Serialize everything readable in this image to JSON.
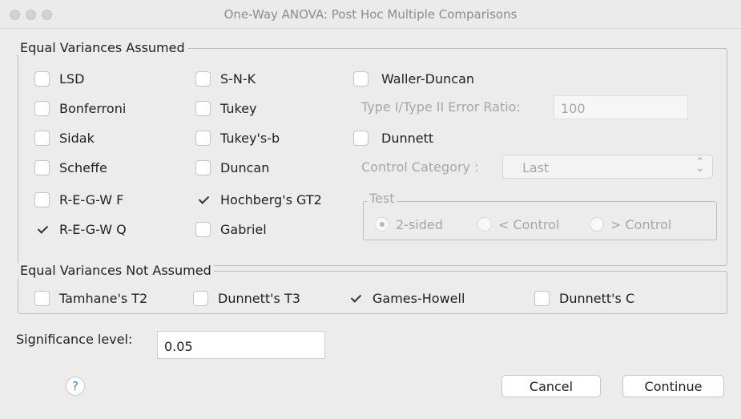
{
  "window": {
    "title": "One-Way ANOVA: Post Hoc Multiple Comparisons"
  },
  "equal_assumed": {
    "legend": "Equal Variances Assumed",
    "col1": [
      {
        "label": "LSD",
        "checked": false
      },
      {
        "label": "Bonferroni",
        "checked": false
      },
      {
        "label": "Sidak",
        "checked": false
      },
      {
        "label": "Scheffe",
        "checked": false
      },
      {
        "label": "R-E-G-W F",
        "checked": false
      },
      {
        "label": "R-E-G-W Q",
        "checked": true
      }
    ],
    "col2": [
      {
        "label": "S-N-K",
        "checked": false
      },
      {
        "label": "Tukey",
        "checked": false
      },
      {
        "label": "Tukey's-b",
        "checked": false
      },
      {
        "label": "Duncan",
        "checked": false
      },
      {
        "label": "Hochberg's GT2",
        "checked": true
      },
      {
        "label": "Gabriel",
        "checked": false
      }
    ],
    "waller_duncan": {
      "label": "Waller-Duncan",
      "checked": false
    },
    "error_ratio_label": "Type I/Type II Error Ratio:",
    "error_ratio_value": "100",
    "dunnett": {
      "label": "Dunnett",
      "checked": false
    },
    "control_category_label": "Control Category :",
    "control_category_value": "Last",
    "test": {
      "legend": "Test",
      "options": [
        {
          "label": "2-sided",
          "selected": true
        },
        {
          "label": "< Control",
          "selected": false
        },
        {
          "label": "> Control",
          "selected": false
        }
      ]
    }
  },
  "equal_not_assumed": {
    "legend": "Equal Variances Not Assumed",
    "items": [
      {
        "label": "Tamhane's T2",
        "checked": false
      },
      {
        "label": "Dunnett's T3",
        "checked": false
      },
      {
        "label": "Games-Howell",
        "checked": true
      },
      {
        "label": "Dunnett's C",
        "checked": false
      }
    ]
  },
  "significance": {
    "label": "Significance level:",
    "value": "0.05"
  },
  "buttons": {
    "help": "?",
    "cancel": "Cancel",
    "continue": "Continue"
  }
}
